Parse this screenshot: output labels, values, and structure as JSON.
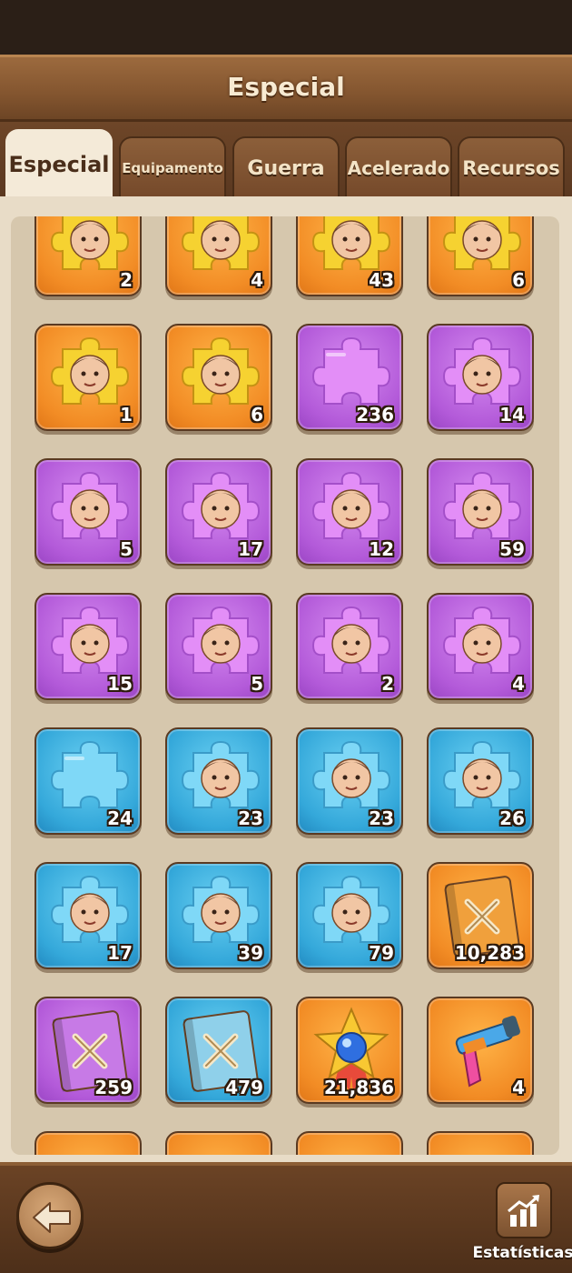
{
  "header": {
    "title": "Especial"
  },
  "tabs": [
    {
      "label": "Especial",
      "active": true
    },
    {
      "label": "Equipamento",
      "active": false
    },
    {
      "label": "Guerra",
      "active": false
    },
    {
      "label": "Acelerado",
      "active": false
    },
    {
      "label": "Recursos",
      "active": false
    }
  ],
  "items": [
    {
      "kind": "hero-fragment",
      "rarity": "orange",
      "count": "2"
    },
    {
      "kind": "hero-fragment",
      "rarity": "orange",
      "count": "4"
    },
    {
      "kind": "hero-fragment",
      "rarity": "orange",
      "count": "43"
    },
    {
      "kind": "hero-fragment",
      "rarity": "orange",
      "count": "6"
    },
    {
      "kind": "hero-fragment",
      "rarity": "orange",
      "count": "1"
    },
    {
      "kind": "hero-fragment",
      "rarity": "orange",
      "count": "6"
    },
    {
      "kind": "universal-fragment",
      "rarity": "purple",
      "count": "236"
    },
    {
      "kind": "hero-fragment",
      "rarity": "purple",
      "count": "14"
    },
    {
      "kind": "hero-fragment",
      "rarity": "purple",
      "count": "5"
    },
    {
      "kind": "hero-fragment",
      "rarity": "purple",
      "count": "17"
    },
    {
      "kind": "hero-fragment",
      "rarity": "purple",
      "count": "12"
    },
    {
      "kind": "hero-fragment",
      "rarity": "purple",
      "count": "59"
    },
    {
      "kind": "hero-fragment",
      "rarity": "purple",
      "count": "15"
    },
    {
      "kind": "hero-fragment",
      "rarity": "purple",
      "count": "5"
    },
    {
      "kind": "hero-fragment",
      "rarity": "purple",
      "count": "2"
    },
    {
      "kind": "hero-fragment",
      "rarity": "purple",
      "count": "4"
    },
    {
      "kind": "universal-fragment",
      "rarity": "blue",
      "count": "24"
    },
    {
      "kind": "hero-fragment",
      "rarity": "blue",
      "count": "23"
    },
    {
      "kind": "hero-fragment",
      "rarity": "blue",
      "count": "23"
    },
    {
      "kind": "hero-fragment",
      "rarity": "blue",
      "count": "26"
    },
    {
      "kind": "hero-fragment",
      "rarity": "blue",
      "count": "17"
    },
    {
      "kind": "hero-fragment",
      "rarity": "blue",
      "count": "39"
    },
    {
      "kind": "hero-fragment",
      "rarity": "blue",
      "count": "79"
    },
    {
      "kind": "skill-book",
      "rarity": "orange",
      "count": "10,283"
    },
    {
      "kind": "skill-book",
      "rarity": "purple",
      "count": "259"
    },
    {
      "kind": "skill-book",
      "rarity": "blue",
      "count": "479"
    },
    {
      "kind": "star-medal",
      "rarity": "orange",
      "count": "21,836"
    },
    {
      "kind": "blaster",
      "rarity": "orange",
      "count": "4"
    }
  ],
  "footer": {
    "stats_label": "Estatísticas"
  },
  "colors": {
    "orange": "#f28c25",
    "purple": "#b35ad9",
    "blue": "#34a8da",
    "wood": "#83552f"
  }
}
